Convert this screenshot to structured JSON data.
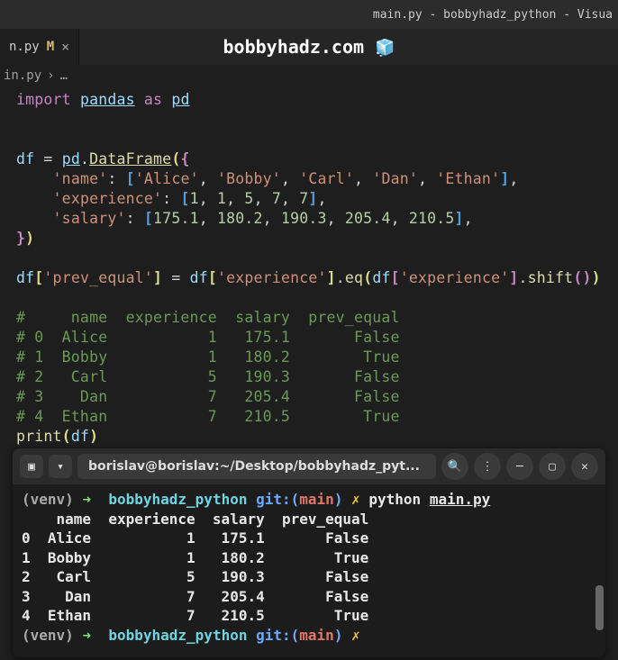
{
  "titlebar": {
    "text": "main.py - bobbyhadz_python - Visua"
  },
  "tab": {
    "name": "n.py",
    "mod": "M",
    "close": "×"
  },
  "watermark": {
    "text": "bobbyhadz.com",
    "icon": "🧊"
  },
  "breadcrumb": {
    "file": "in.py",
    "sep": "›",
    "dots": "…"
  },
  "editor": {
    "import": "import",
    "pandas": "pandas",
    "as": "as",
    "pd": "pd",
    "df": "df",
    "eq": "=",
    "DataFrame": "DataFrame",
    "dict_open": "{",
    "name_key": "'name'",
    "colon": ":",
    "names": [
      "'Alice'",
      "'Bobby'",
      "'Carl'",
      "'Dan'",
      "'Ethan'"
    ],
    "exp_key": "'experience'",
    "exps": [
      "1",
      "1",
      "5",
      "7",
      "7"
    ],
    "sal_key": "'salary'",
    "sals": [
      "175.1",
      "180.2",
      "190.3",
      "205.4",
      "210.5"
    ],
    "dict_close": "}",
    "prev_equal_key": "'prev_equal'",
    "eqfn": "eq",
    "shiftfn": "shift",
    "comments": [
      "#     name  experience  salary  prev_equal",
      "# 0  Alice           1   175.1       False",
      "# 1  Bobby           1   180.2        True",
      "# 2   Carl           5   190.3       False",
      "# 3    Dan           7   205.4       False",
      "# 4  Ethan           7   210.5        True"
    ],
    "print": "print"
  },
  "terminal": {
    "title": "borislav@borislav:~/Desktop/bobbyhadz_pyt...",
    "venv": "(venv)",
    "arrow": "➜",
    "dir": "bobbyhadz_python",
    "git": "git:(",
    "branch": "main",
    "git_close": ")",
    "x": "✗",
    "cmd": "python",
    "script": "main.py",
    "out_header": "    name  experience  salary  prev_equal",
    "rows": [
      "0  Alice           1   175.1       False",
      "1  Bobby           1   180.2        True",
      "2   Carl           5   190.3       False",
      "3    Dan           7   205.4       False",
      "4  Ethan           7   210.5        True"
    ]
  }
}
